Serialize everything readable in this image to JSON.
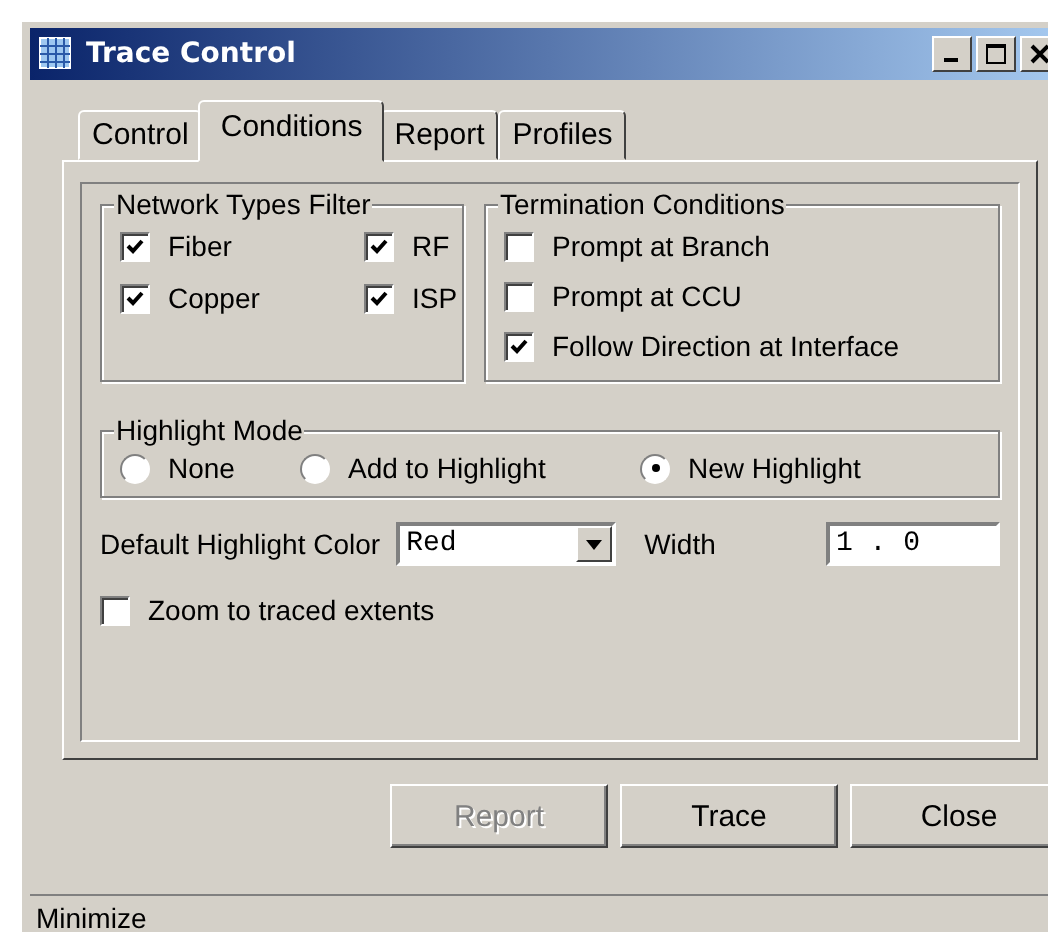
{
  "window": {
    "title": "Trace Control"
  },
  "tabs": [
    {
      "label": "Control",
      "selected": false
    },
    {
      "label": "Conditions",
      "selected": true
    },
    {
      "label": "Report",
      "selected": false
    },
    {
      "label": "Profiles",
      "selected": false
    }
  ],
  "network_types_filter": {
    "title": "Network Types Filter",
    "options": [
      {
        "label": "Fiber",
        "checked": true
      },
      {
        "label": "RF",
        "checked": true
      },
      {
        "label": "Copper",
        "checked": true
      },
      {
        "label": "ISP",
        "checked": true
      }
    ]
  },
  "termination_conditions": {
    "title": "Termination Conditions",
    "options": [
      {
        "label": "Prompt at Branch",
        "checked": false
      },
      {
        "label": "Prompt at CCU",
        "checked": false
      },
      {
        "label": "Follow Direction at Interface",
        "checked": true
      }
    ]
  },
  "highlight_mode": {
    "title": "Highlight Mode",
    "options": [
      {
        "label": "None",
        "selected": false
      },
      {
        "label": "Add to Highlight",
        "selected": false
      },
      {
        "label": "New Highlight",
        "selected": true
      }
    ]
  },
  "default_highlight_color": {
    "label": "Default Highlight Color",
    "value": "Red"
  },
  "width": {
    "label": "Width",
    "value": "1 . 0"
  },
  "zoom_to_traced_extents": {
    "label": "Zoom to traced extents",
    "checked": false
  },
  "buttons": [
    {
      "label": "Report",
      "disabled": true
    },
    {
      "label": "Trace",
      "disabled": false
    },
    {
      "label": "Close",
      "disabled": false
    }
  ],
  "status_bar": {
    "text": "Minimize"
  }
}
